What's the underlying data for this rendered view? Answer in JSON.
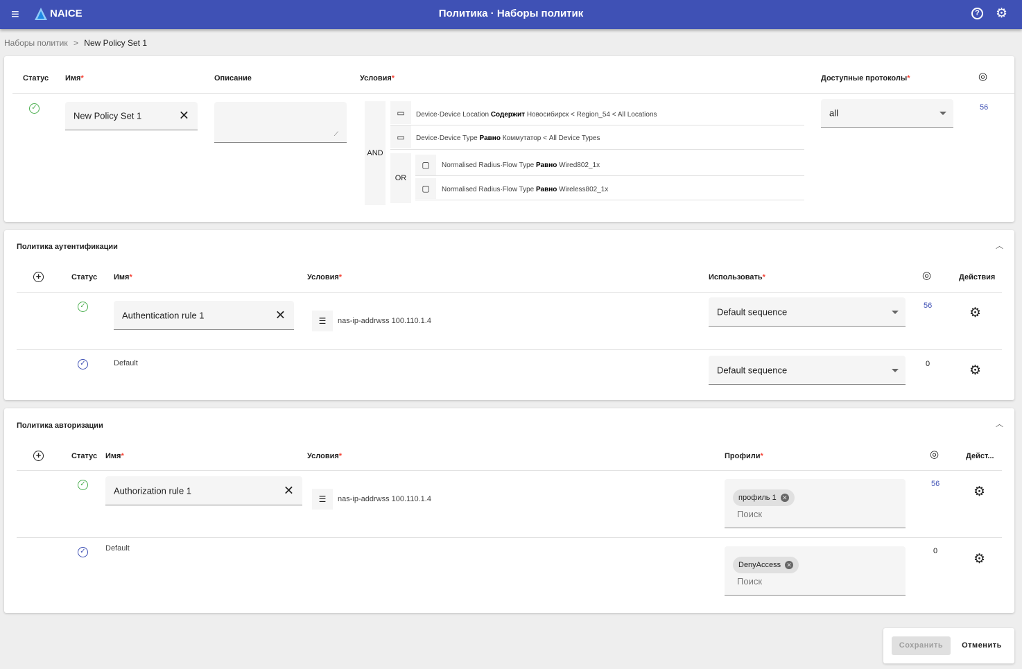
{
  "header": {
    "app_name": "NAICE",
    "title": "Политика · Наборы политик",
    "icons": [
      "menu-icon",
      "help-icon",
      "gear-icon"
    ]
  },
  "breadcrumb": {
    "parent": "Наборы политик",
    "sep": ">",
    "current": "New Policy Set 1"
  },
  "policy_set": {
    "columns": {
      "status": "Статус",
      "name": "Имя",
      "description": "Описание",
      "conditions": "Условия",
      "protocols": "Доступные протоколы"
    },
    "name_value": "New Policy Set 1",
    "description_value": "",
    "and_label": "AND",
    "or_label": "OR",
    "conditions": [
      {
        "pre": "Device·Device Location ",
        "op": "Содержит",
        "post": " Новосибирск < Region_54 < All Locations"
      },
      {
        "pre": "Device·Device Type ",
        "op": "Равно",
        "post": " Коммутатор < All Device Types"
      },
      {
        "pre": "Normalised Radius·Flow Type ",
        "op": "Равно",
        "post": " Wired802_1x"
      },
      {
        "pre": "Normalised Radius·Flow Type ",
        "op": "Равно",
        "post": " Wireless802_1x"
      }
    ],
    "protocol_value": "all",
    "hits": "56"
  },
  "auth": {
    "title": "Политика аутентификации",
    "columns": {
      "status": "Статус",
      "name": "Имя",
      "conditions": "Условия",
      "use": "Использовать",
      "actions": "Действия"
    },
    "rows": [
      {
        "name": "Authentication rule 1",
        "condition": "nas-ip-addrwss 100.110.1.4",
        "use": "Default sequence",
        "hits": "56"
      },
      {
        "name": "Default",
        "use": "Default sequence",
        "hits": "0"
      }
    ]
  },
  "authz": {
    "title": "Политика авторизации",
    "columns": {
      "status": "Статус",
      "name": "Имя",
      "conditions": "Условия",
      "profiles": "Профили",
      "actions": "Дейст..."
    },
    "rows": [
      {
        "name": "Authorization rule 1",
        "condition": "nas-ip-addrwss 100.110.1.4",
        "chip": "профиль 1",
        "search": "Поиск",
        "hits": "56"
      },
      {
        "name": "Default",
        "chip": "DenyAccess",
        "search": "Поиск",
        "hits": "0"
      }
    ]
  },
  "footer": {
    "save": "Сохранить",
    "cancel": "Отменить"
  },
  "colors": {
    "primary": "#3f51b5",
    "success": "#4caf50",
    "required": "#f44336"
  }
}
